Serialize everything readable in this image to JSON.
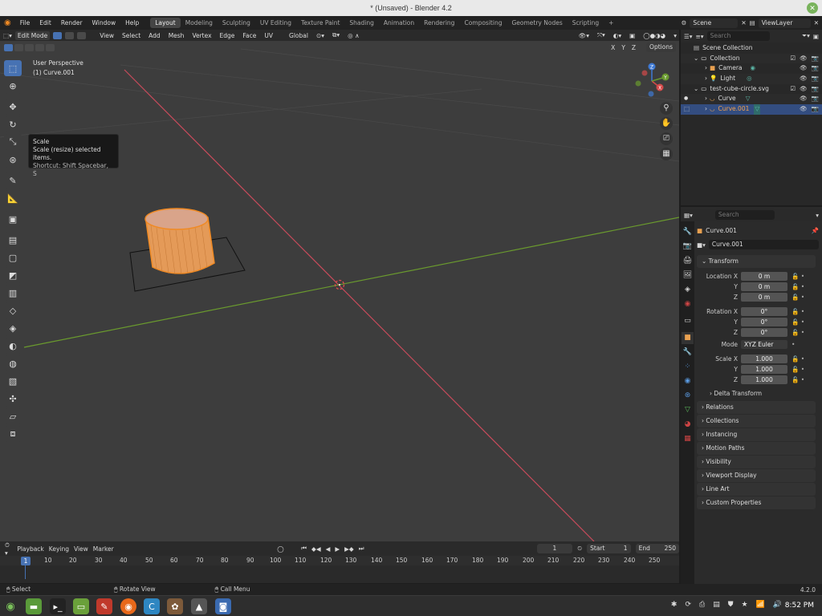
{
  "window": {
    "title": "* (Unsaved) - Blender 4.2"
  },
  "menu": [
    "File",
    "Edit",
    "Render",
    "Window",
    "Help"
  ],
  "workspaces": [
    "Layout",
    "Modeling",
    "Sculpting",
    "UV Editing",
    "Texture Paint",
    "Shading",
    "Animation",
    "Rendering",
    "Compositing",
    "Geometry Nodes",
    "Scripting"
  ],
  "scene": {
    "name": "Scene",
    "view_layer": "ViewLayer"
  },
  "viewport_header": {
    "mode": "Edit Mode",
    "menus": [
      "View",
      "Select",
      "Add",
      "Mesh",
      "Vertex",
      "Edge",
      "Face",
      "UV"
    ],
    "orientation": "Global",
    "options": "Options",
    "axes": [
      "X",
      "Y",
      "Z"
    ]
  },
  "viewport": {
    "perspective": "User Perspective",
    "object": "(1) Curve.001"
  },
  "tooltip": {
    "title": "Scale",
    "desc": "Scale (resize) selected items.",
    "shortcut": "Shortcut: Shift Spacebar, S"
  },
  "outliner": {
    "search": "Search",
    "items": [
      {
        "label": "Scene Collection"
      },
      {
        "label": "Collection"
      },
      {
        "label": "Camera"
      },
      {
        "label": "Light"
      },
      {
        "label": "test-cube-circle.svg"
      },
      {
        "label": "Curve"
      },
      {
        "label": "Curve.001"
      }
    ]
  },
  "properties": {
    "search": "Search",
    "object_name": "Curve.001",
    "datablock": "Curve.001",
    "transform_label": "Transform",
    "location": {
      "label": "Location X",
      "x": "0 m",
      "y": "0 m",
      "z": "0 m"
    },
    "rotation": {
      "label": "Rotation X",
      "x": "0°",
      "y": "0°",
      "z": "0°"
    },
    "mode": {
      "label": "Mode",
      "value": "XYZ Euler"
    },
    "scale": {
      "label": "Scale X",
      "x": "1.000",
      "y": "1.000",
      "z": "1.000"
    },
    "axis_y": "Y",
    "axis_z": "Z",
    "delta": "Delta Transform",
    "panels": [
      "Relations",
      "Collections",
      "Instancing",
      "Motion Paths",
      "Visibility",
      "Viewport Display",
      "Line Art",
      "Custom Properties"
    ]
  },
  "timeline": {
    "menus": [
      "Playback",
      "Keying",
      "View",
      "Marker"
    ],
    "current_frame": "1",
    "start_label": "Start",
    "start": "1",
    "end_label": "End",
    "end": "250",
    "ticks": [
      "10",
      "20",
      "30",
      "40",
      "50",
      "60",
      "70",
      "80",
      "90",
      "100",
      "110",
      "120",
      "130",
      "140",
      "150",
      "160",
      "170",
      "180",
      "190",
      "200",
      "210",
      "220",
      "230",
      "240",
      "250"
    ],
    "playhead": "1"
  },
  "statusbar": {
    "select": "Select",
    "rotate": "Rotate View",
    "menu": "Call Menu",
    "version": "4.2.0"
  },
  "taskbar": {
    "time": "8:52 PM"
  },
  "colors": {
    "accent": "#4772b3",
    "x_axis": "#c84b5b",
    "y_axis": "#6a9a2e",
    "object": "#f08a24"
  }
}
